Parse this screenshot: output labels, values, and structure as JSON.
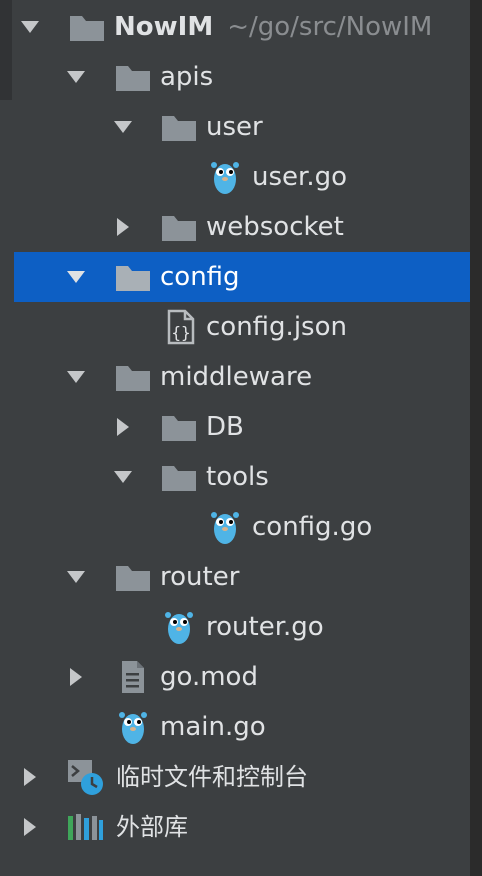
{
  "project": {
    "name": "NowIM",
    "path": "~/go/src/NowIM"
  },
  "tree": {
    "apis": "apis",
    "user": "user",
    "user_go": "user.go",
    "websocket": "websocket",
    "config": "config",
    "config_json": "config.json",
    "middleware": "middleware",
    "db": "DB",
    "tools": "tools",
    "config_go": "config.go",
    "router": "router",
    "router_go": "router.go",
    "go_mod": "go.mod",
    "main_go": "main.go",
    "scratches": "临时文件和控制台",
    "external_libs": "外部库"
  },
  "colors": {
    "background": "#3c3f41",
    "selection": "#0d5fc4",
    "folder": "#8c9399",
    "gopher": "#4fb4e6",
    "arrow": "#c5c7c9",
    "path_hint": "#8a8d90"
  },
  "icons": {
    "folder": "folder-icon",
    "go_file": "gopher-icon",
    "json_file": "json-file-icon",
    "text_file": "text-file-icon",
    "scratches": "scratches-clock-icon",
    "libraries": "library-icon"
  },
  "selected": "config"
}
